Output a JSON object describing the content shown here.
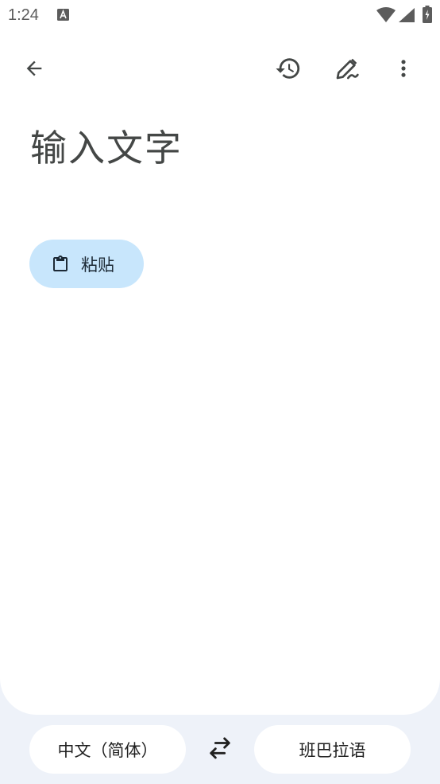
{
  "status_bar": {
    "time": "1:24",
    "notification_icon": "a-icon",
    "icons": [
      "wifi-icon",
      "signal-icon",
      "battery-charging-icon"
    ]
  },
  "toolbar": {
    "back_icon": "arrow-back-icon",
    "history_icon": "history-icon",
    "handwriting_icon": "handwriting-icon",
    "more_icon": "more-vert-icon"
  },
  "input": {
    "placeholder": "输入文字"
  },
  "paste_chip": {
    "icon": "clipboard-icon",
    "label": "粘贴"
  },
  "language_bar": {
    "source_language": "中文（简体）",
    "swap_icon": "swap-arrows-icon",
    "target_language": "班巴拉语"
  },
  "colors": {
    "sheet_background": "#ffffff",
    "page_background": "#eef2f9",
    "chip_background": "#c8e6fc",
    "icon_color": "#444746"
  }
}
